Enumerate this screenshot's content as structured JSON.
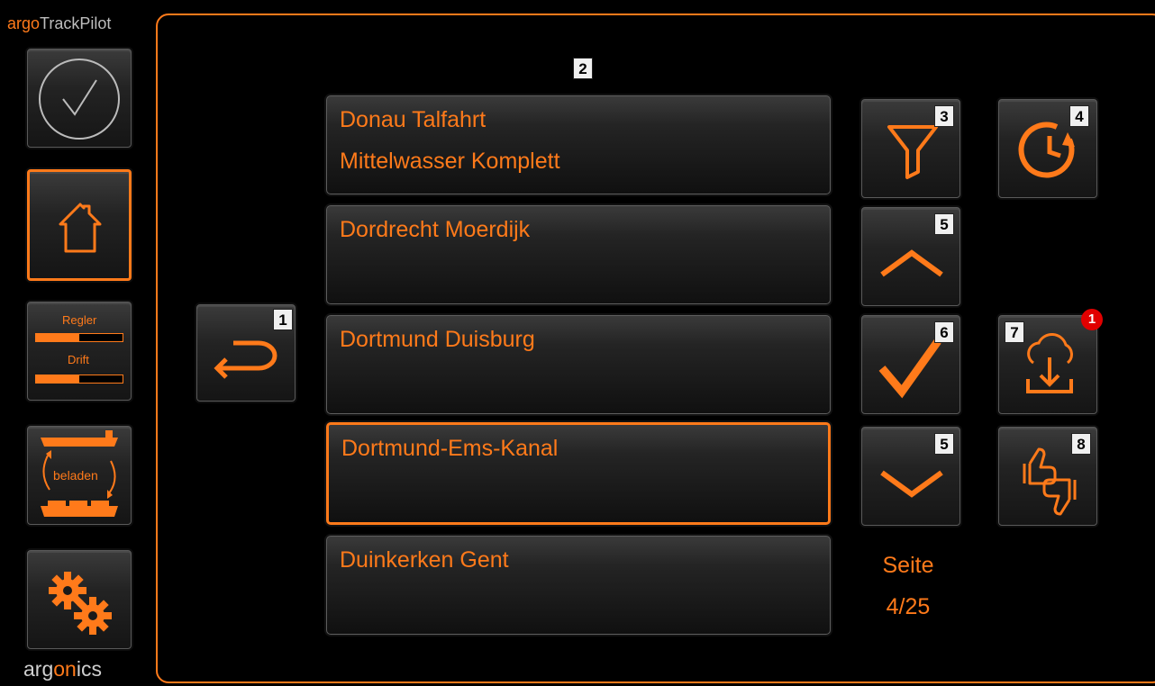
{
  "app": {
    "brand_prefix": "argo",
    "brand_suffix": "TrackPilot",
    "footer_prefix": "arg",
    "footer_highlight": "on",
    "footer_suffix": "ics"
  },
  "colors": {
    "accent": "#ff7a1a",
    "background": "#000000",
    "notification": "#e10000"
  },
  "sidebar": {
    "status_icon": "check-circle-icon",
    "home_icon": "home-icon",
    "meters": {
      "label_top": "Regler",
      "label_bottom": "Drift",
      "level_top": 0.5,
      "level_bottom": 0.5
    },
    "load_label": "beladen",
    "settings_icon": "gears-icon"
  },
  "markers": {
    "back": "1",
    "list": "2",
    "filter": "3",
    "history": "4",
    "up": "5",
    "confirm": "6",
    "download": "7",
    "rate": "8",
    "down": "5"
  },
  "download_notification": "1",
  "list": {
    "items": [
      {
        "line1": "Donau Talfahrt",
        "line2": "Mittelwasser Komplett"
      },
      {
        "line1": "Dordrecht Moerdijk",
        "line2": ""
      },
      {
        "line1": "Dortmund Duisburg",
        "line2": ""
      },
      {
        "line1": "Dortmund-Ems-Kanal",
        "line2": "",
        "selected": true
      },
      {
        "line1": "Duinkerken Gent",
        "line2": ""
      }
    ]
  },
  "paging": {
    "label": "Seite",
    "value": "4/25"
  }
}
